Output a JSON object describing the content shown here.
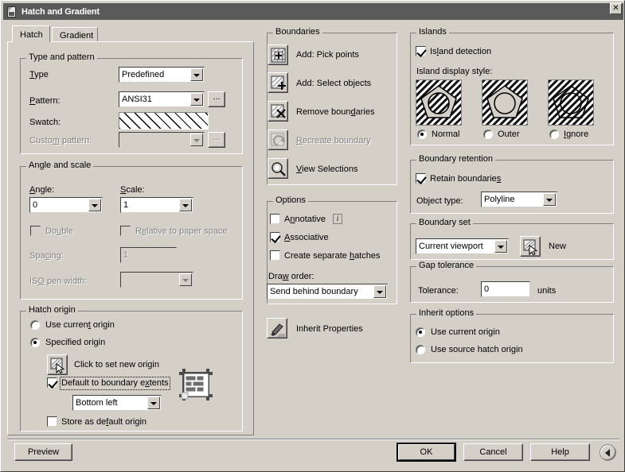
{
  "window": {
    "title": "Hatch and Gradient",
    "icon": "hatch-dialog-icon",
    "close_label": "✕"
  },
  "tabs": [
    {
      "label": "Hatch",
      "active": true
    },
    {
      "label": "Gradient",
      "active": false
    }
  ],
  "type_and_pattern": {
    "group_title": "Type and pattern",
    "type_label": "Type",
    "type_value": "Predefined",
    "pattern_label": "Pattern:",
    "pattern_value": "ANSI31",
    "pattern_browse_label": "...",
    "swatch_label": "Swatch:",
    "swatch_pattern": "ANSI31 45-degree diagonal lines",
    "custom_label": "Custom pattern:",
    "custom_value": "",
    "custom_browse_label": "...",
    "custom_enabled": false
  },
  "angle_and_scale": {
    "group_title": "Angle and scale",
    "angle_label": "Angle:",
    "angle_value": "0",
    "scale_label": "Scale:",
    "scale_value": "1",
    "double_label": "Double",
    "double_checked": false,
    "double_enabled": false,
    "relative_label": "Relative to paper space",
    "relative_checked": false,
    "relative_enabled": false,
    "spacing_label": "Spacing:",
    "spacing_value": "1",
    "spacing_enabled": false,
    "iso_pen_label": "ISO pen width:",
    "iso_pen_value": "",
    "iso_pen_enabled": false
  },
  "hatch_origin": {
    "group_title": "Hatch origin",
    "use_current_label": "Use current origin",
    "use_current_selected": false,
    "specified_label": "Specified origin",
    "specified_selected": true,
    "click_set_label": "Click to set new origin",
    "click_set_icon": "pick-point-icon",
    "default_extents_label": "Default to boundary extents",
    "default_extents_checked": true,
    "extents_value": "Bottom left",
    "extents_preview_icon": "brick-extents-icon",
    "store_default_label": "Store as default origin",
    "store_default_checked": false
  },
  "boundaries": {
    "group_title": "Boundaries",
    "items": [
      {
        "label": "Add: Pick points",
        "icon": "add-pick-points-icon",
        "enabled": true
      },
      {
        "label": "Add: Select objects",
        "icon": "add-select-objects-icon",
        "enabled": true
      },
      {
        "label": "Remove boundaries",
        "icon": "remove-boundaries-icon",
        "enabled": true
      },
      {
        "label": "Recreate boundary",
        "icon": "recreate-boundary-icon",
        "enabled": false
      },
      {
        "label": "View Selections",
        "icon": "view-selections-icon",
        "enabled": true
      }
    ]
  },
  "options": {
    "group_title": "Options",
    "annotative_label": "Annotative",
    "annotative_checked": false,
    "annotative_info_icon": "info-icon",
    "annotative_info_glyph": "i",
    "associative_label": "Associative",
    "associative_checked": true,
    "separate_hatches_label": "Create separate hatches",
    "separate_hatches_checked": false,
    "draw_order_label": "Draw order:",
    "draw_order_value": "Send behind boundary"
  },
  "inherit_properties": {
    "label": "Inherit Properties",
    "icon": "inherit-properties-icon"
  },
  "islands": {
    "group_title": "Islands",
    "detection_label": "Island detection",
    "detection_checked": true,
    "display_style_label": "Island display style:",
    "styles": [
      {
        "label": "Normal",
        "selected": true,
        "icon": "island-normal-icon"
      },
      {
        "label": "Outer",
        "selected": false,
        "icon": "island-outer-icon"
      },
      {
        "label": "Ignore",
        "selected": false,
        "icon": "island-ignore-icon"
      }
    ]
  },
  "boundary_retention": {
    "group_title": "Boundary retention",
    "retain_label": "Retain boundaries",
    "retain_checked": true,
    "object_type_label": "Object type:",
    "object_type_value": "Polyline"
  },
  "boundary_set": {
    "group_title": "Boundary set",
    "value": "Current viewport",
    "new_button_label": "New",
    "new_button_icon": "pick-point-icon"
  },
  "gap_tolerance": {
    "group_title": "Gap tolerance",
    "tolerance_label": "Tolerance:",
    "tolerance_value": "0",
    "units_label": "units"
  },
  "inherit_options": {
    "group_title": "Inherit options",
    "use_current_label": "Use current origin",
    "use_current_selected": true,
    "use_source_label": "Use source hatch origin",
    "use_source_selected": false
  },
  "footer": {
    "preview_label": "Preview",
    "ok_label": "OK",
    "cancel_label": "Cancel",
    "help_label": "Help",
    "expand_icon": "expand-less-arrow-icon"
  },
  "colors": {
    "dialog_face": "#d4d0c8",
    "titlebar": "#5a5a5a",
    "titlebar_text": "#ffffff",
    "field_bg": "#ffffff",
    "disabled_text": "#808080"
  }
}
